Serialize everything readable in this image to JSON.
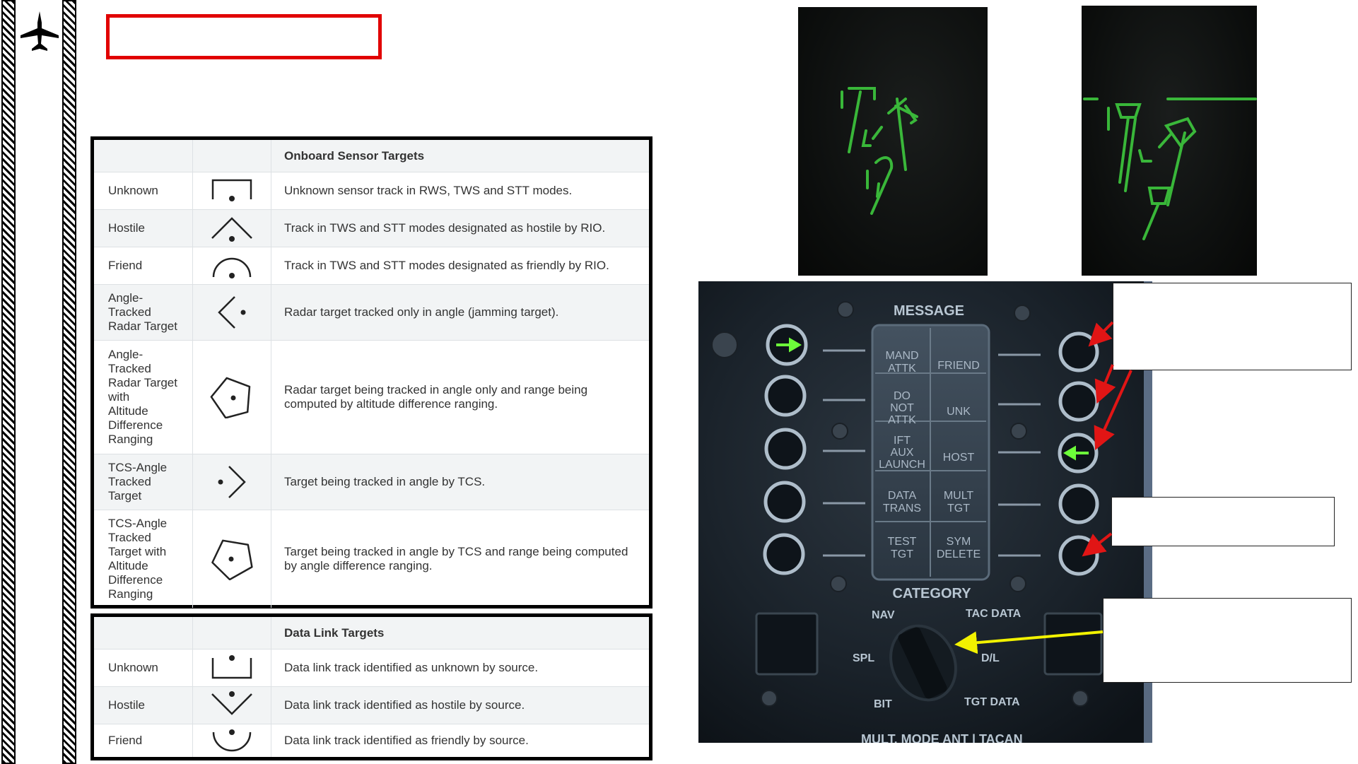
{
  "onboard_table": {
    "header": "Onboard Sensor Targets",
    "rows": [
      {
        "name": "Unknown",
        "symbol": "unknown-sensor-track-icon",
        "description": "Unknown sensor track in RWS, TWS and STT modes."
      },
      {
        "name": "Hostile",
        "symbol": "hostile-track-icon",
        "description": "Track in TWS and STT modes designated as hostile by RIO."
      },
      {
        "name": "Friend",
        "symbol": "friend-track-icon",
        "description": "Track in TWS and STT modes designated as friendly by RIO."
      },
      {
        "name": "Angle-\nTracked\nRadar Target",
        "symbol": "angle-tracked-target-icon",
        "description": "Radar target tracked only in angle (jamming target)."
      },
      {
        "name": "Angle-\nTracked\nRadar Target\nwith\nAltitude\nDifference\nRanging",
        "symbol": "angle-tracked-altitude-ranging-icon",
        "description": "Radar target being tracked in angle only and range being computed by altitude difference ranging."
      },
      {
        "name": "TCS-Angle\nTracked\nTarget",
        "symbol": "tcs-angle-tracked-icon",
        "description": "Target being tracked in angle by TCS."
      },
      {
        "name": "TCS-Angle\nTracked\nTarget with\nAltitude\nDifference\nRanging",
        "symbol": "tcs-angle-tracked-ranging-icon",
        "description": "Target being tracked in angle by TCS and range being computed by angle difference ranging."
      }
    ]
  },
  "datalink_table": {
    "header": "Data Link Targets",
    "rows": [
      {
        "name": "Unknown",
        "symbol": "datalink-unknown-icon",
        "description": "Data link track identified as unknown by source."
      },
      {
        "name": "Hostile",
        "symbol": "datalink-hostile-icon",
        "description": "Data link track identified as hostile by source."
      },
      {
        "name": "Friend",
        "symbol": "datalink-friend-icon",
        "description": "Data link track identified as friendly by source."
      }
    ]
  },
  "panel": {
    "message_label": "MESSAGE",
    "category_label": "CATEGORY",
    "left_cells": [
      "MAND\nATTK",
      "DO\nNOT\nATTK",
      "IFT\nAUX\nLAUNCH",
      "DATA\nTRANS",
      "TEST\nTGT"
    ],
    "right_cells": [
      "FRIEND",
      "UNK",
      "HOST",
      "MULT\nTGT",
      "SYM\nDELETE"
    ],
    "selector": {
      "nav": "NAV",
      "tac_data": "TAC DATA",
      "spl": "SPL",
      "dl": "D/L",
      "bit": "BIT",
      "tgt_data": "TGT DATA"
    },
    "bottom_strip": "MULT. MODE ANT | TACAN"
  },
  "colors": {
    "title_box_border": "#e10000",
    "hud_symbology": "#3ec93e",
    "arrow_red": "#e11515",
    "arrow_yellow": "#f2f200",
    "light_green": "#6dff3a"
  }
}
